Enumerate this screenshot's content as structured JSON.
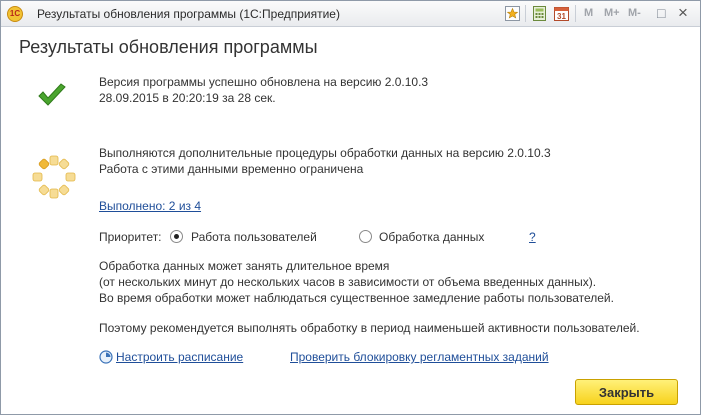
{
  "window": {
    "title": "Результаты обновления программы  (1С:Предприятие)",
    "logo_text": "1С",
    "toolbar": {
      "icons": [
        "favorite-icon",
        "calculator-icon",
        "calendar-icon"
      ],
      "calendar_day": "31",
      "memory_buttons": [
        "M",
        "M+",
        "M-"
      ],
      "restore_glyph": "□",
      "close_glyph": "×"
    }
  },
  "page": {
    "heading": "Результаты обновления программы"
  },
  "update": {
    "success_line1": "Версия программы успешно обновлена на версию 2.0.10.3",
    "success_line2": "28.09.2015 в 20:20:19 за 28 сек.",
    "processing_line1": "Выполняются дополнительные процедуры обработки данных на версию 2.0.10.3",
    "processing_line2": "Работа с этими данными временно ограничена",
    "progress_link": "Выполнено: 2 из 4",
    "progress_done": 2,
    "progress_total": 4
  },
  "priority": {
    "label": "Приоритет:",
    "options": [
      {
        "label": "Работа пользователей",
        "selected": true
      },
      {
        "label": "Обработка данных",
        "selected": false
      }
    ],
    "help_link": "?"
  },
  "notes": {
    "line1": "Обработка данных может занять длительное время",
    "line2": "(от нескольких минут до нескольких часов в зависимости от объема введенных данных).",
    "line3": "Во время обработки может наблюдаться существенное замедление работы пользователей.",
    "line4": "Поэтому рекомендуется выполнять обработку в период наименьшей активности пользователей."
  },
  "links": {
    "schedule": "Настроить расписание",
    "check_lock": "Проверить блокировку регламентных заданий"
  },
  "actions": {
    "close_label": "Закрыть"
  },
  "colors": {
    "accent_yellow": "#f7d21c",
    "link": "#1f4e99",
    "success_green": "#4aa52e",
    "spinner": "#f3c24b"
  }
}
